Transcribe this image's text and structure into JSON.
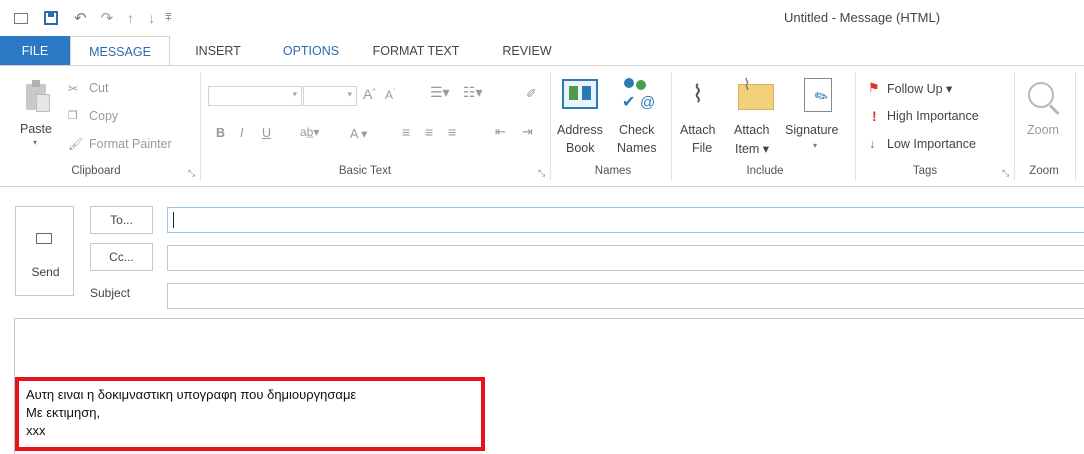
{
  "window": {
    "title": "Untitled - Message (HTML)"
  },
  "tabs": [
    {
      "label": "FILE"
    },
    {
      "label": "MESSAGE"
    },
    {
      "label": "INSERT"
    },
    {
      "label": "OPTIONS"
    },
    {
      "label": "FORMAT TEXT"
    },
    {
      "label": "REVIEW"
    }
  ],
  "ribbon": {
    "clipboard": {
      "group": "Clipboard",
      "paste": "Paste",
      "cut": "Cut",
      "copy": "Copy",
      "format_painter": "Format Painter"
    },
    "basic_text": {
      "group": "Basic Text",
      "bold": "B",
      "italic": "I",
      "underline": "U",
      "font_color": "A"
    },
    "names": {
      "group": "Names",
      "address_book_1": "Address",
      "address_book_2": "Book",
      "check_names_1": "Check",
      "check_names_2": "Names"
    },
    "include": {
      "group": "Include",
      "attach_file_1": "Attach",
      "attach_file_2": "File",
      "attach_item_1": "Attach",
      "attach_item_2": "Item ▾",
      "signature": "Signature"
    },
    "tags": {
      "group": "Tags",
      "follow_up": "Follow Up ▾",
      "high_importance": "High Importance",
      "low_importance": "Low Importance"
    },
    "zoom": {
      "group": "Zoom",
      "zoom": "Zoom"
    }
  },
  "compose": {
    "send": "Send",
    "to": "To...",
    "cc": "Cc...",
    "subject": "Subject",
    "to_value": "",
    "cc_value": "",
    "subject_value": ""
  },
  "signature": {
    "line1": "Αυτη ειναι η δοκιμναστικη υπογραφη που δημιουργησαμε",
    "line2": "Με εκτιμηση,",
    "line3": "xxx"
  },
  "colors": {
    "file_tab": "#2b79c4",
    "active_tab_text": "#2b6cb0",
    "highlight_border": "#e8121b",
    "follow_up_flag": "#e0362a",
    "importance_high": "#d03b2a",
    "importance_low": "#2b79c4"
  }
}
